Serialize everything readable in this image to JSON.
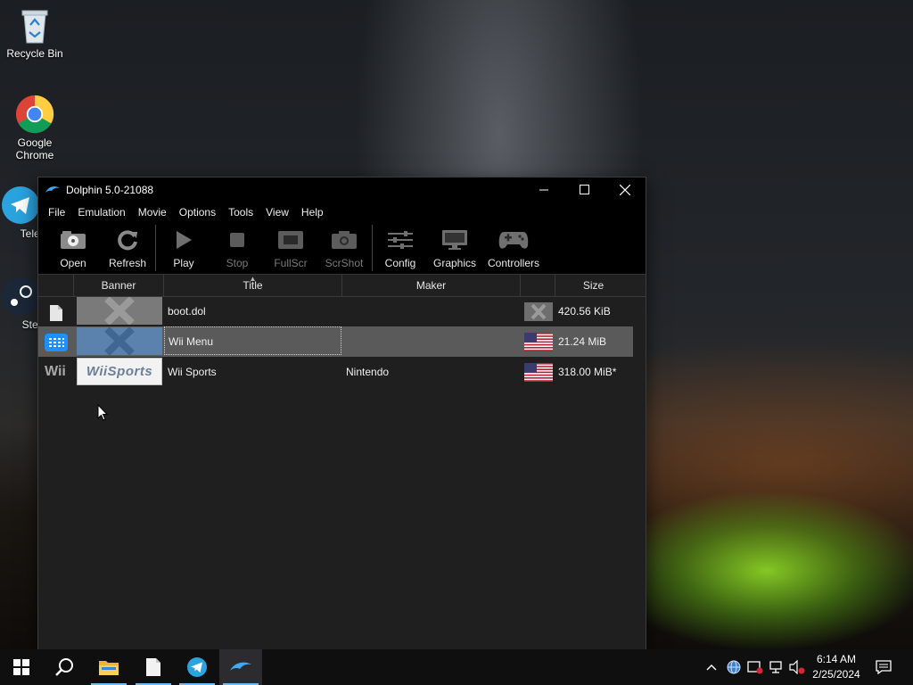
{
  "desktop": {
    "icons": [
      {
        "label": "Recycle Bin"
      },
      {
        "label": "Google Chrome"
      },
      {
        "label": "Teleg"
      },
      {
        "label": "Stea"
      }
    ]
  },
  "window": {
    "title": "Dolphin 5.0-21088",
    "menu": [
      "File",
      "Emulation",
      "Movie",
      "Options",
      "Tools",
      "View",
      "Help"
    ],
    "toolbar": [
      {
        "label": "Open",
        "icon": "open-disc-icon",
        "enabled": true
      },
      {
        "label": "Refresh",
        "icon": "refresh-icon",
        "enabled": true
      },
      {
        "label": "Play",
        "icon": "play-icon",
        "enabled": true
      },
      {
        "label": "Stop",
        "icon": "stop-icon",
        "enabled": false
      },
      {
        "label": "FullScr",
        "icon": "fullscreen-icon",
        "enabled": false
      },
      {
        "label": "ScrShot",
        "icon": "camera-icon",
        "enabled": false
      },
      {
        "label": "Config",
        "icon": "sliders-icon",
        "enabled": true
      },
      {
        "label": "Graphics",
        "icon": "monitor-icon",
        "enabled": true
      },
      {
        "label": "Controllers",
        "icon": "gamepad-icon",
        "enabled": true
      }
    ],
    "columns": {
      "banner": "Banner",
      "title": "Title",
      "maker": "Maker",
      "size": "Size"
    },
    "games": [
      {
        "platform_icon": "file-icon",
        "banner": "placeholder-x",
        "title": "boot.dol",
        "maker": "",
        "region_icon": "unknown-region-icon",
        "size": "420.56 KiB",
        "selected": false
      },
      {
        "platform_icon": "wii-menu-icon",
        "banner": "placeholder-x",
        "title": "Wii Menu",
        "maker": "",
        "region_icon": "us-flag-icon",
        "size": "21.24 MiB",
        "selected": true
      },
      {
        "platform": "Wii",
        "platform_icon": "wii-platform-icon",
        "banner": "wii-sports-logo",
        "banner_text": "WiiSports",
        "title": "Wii Sports",
        "maker": "Nintendo",
        "region_icon": "us-flag-icon",
        "size": "318.00 MiB*",
        "selected": false
      }
    ]
  },
  "taskbar": {
    "apps": [
      "start-icon",
      "search-icon",
      "file-explorer-icon",
      "notepad-icon",
      "telegram-icon",
      "dolphin-icon"
    ],
    "clock_time": "6:14 AM",
    "clock_date": "2/25/2024"
  },
  "colors": {
    "selection": "#5a5a5a",
    "accent": "#76b9ed",
    "wii_menu_blue": "#1e90ff"
  }
}
